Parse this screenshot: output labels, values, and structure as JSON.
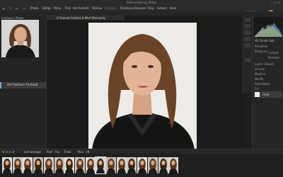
{
  "window": {
    "title": "Selfcontaining_Photo"
  },
  "menu": [
    "Photo",
    "Edtap",
    "Prmo",
    "Fnd",
    "Ard Samolt",
    "Stalrue",
    "Futsenc",
    "Filelstone",
    "Donsore",
    "Timp",
    "Gelves",
    "Henl"
  ],
  "document": {
    "tab_title": "A Fonemt Fohtait & Mtaf Menvorty"
  },
  "left_panel": {
    "tab": "Lentosur: Photo",
    "selected_item": "Art Fashion Fashoid"
  },
  "right_panel": {
    "tabs": "Hit   Srnak  Gok",
    "rows": [
      "Prooalion",
      "Bimpunx",
      "Cumne",
      "Pormtss",
      "Laytu: Chulch",
      "Oacuty",
      "Moptrst",
      "Hacfle",
      "Solor/Holor",
      "Fur"
    ],
    "layer_name": "Flute"
  },
  "bottom_bar": {
    "label": "Lomanwags",
    "items": [
      "Ansl",
      "Fas",
      "Tinat",
      "Nuo",
      "Ht"
    ]
  },
  "filmstrip": {
    "count": 17,
    "selected_index": 9
  },
  "colors": {
    "ui_bg": "#1e1e1e",
    "panel": "#262626",
    "accent": "#7fa0c6"
  }
}
